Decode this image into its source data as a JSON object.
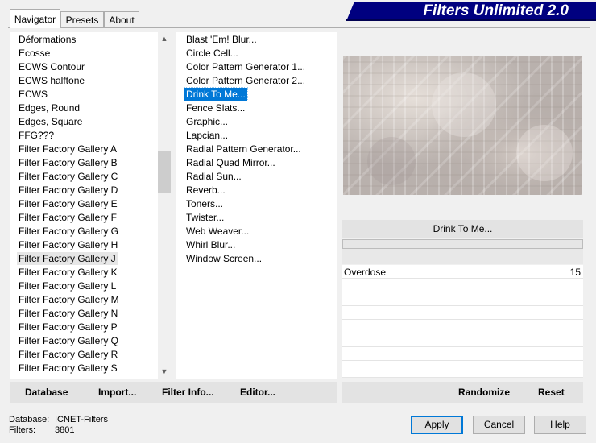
{
  "banner": {
    "title": "Filters Unlimited 2.0"
  },
  "tabs": [
    {
      "label": "Navigator",
      "active": true
    },
    {
      "label": "Presets",
      "active": false
    },
    {
      "label": "About",
      "active": false
    }
  ],
  "categories": [
    "Déformations",
    "Ecosse",
    "ECWS Contour",
    "ECWS halftone",
    "ECWS",
    "Edges, Round",
    "Edges, Square",
    "FFG???",
    "Filter Factory Gallery A",
    "Filter Factory Gallery B",
    "Filter Factory Gallery C",
    "Filter Factory Gallery D",
    "Filter Factory Gallery E",
    "Filter Factory Gallery F",
    "Filter Factory Gallery G",
    "Filter Factory Gallery H",
    "Filter Factory Gallery J",
    "Filter Factory Gallery K",
    "Filter Factory Gallery L",
    "Filter Factory Gallery M",
    "Filter Factory Gallery N",
    "Filter Factory Gallery P",
    "Filter Factory Gallery Q",
    "Filter Factory Gallery R",
    "Filter Factory Gallery S"
  ],
  "selected_category": "Filter Factory Gallery J",
  "filters": [
    "Blast 'Em! Blur...",
    "Circle Cell...",
    "Color Pattern Generator 1...",
    "Color Pattern Generator 2...",
    "Drink To Me...",
    "Fence Slats...",
    "Graphic...",
    "Lapcian...",
    "Radial Pattern Generator...",
    "Radial Quad Mirror...",
    "Radial Sun...",
    "Reverb...",
    "Toners...",
    "Twister...",
    "Web Weaver...",
    "Whirl Blur...",
    "Window Screen..."
  ],
  "selected_filter": "Drink To Me...",
  "preview": {
    "filter_name": "Drink To Me..."
  },
  "params": [
    {
      "name": "Overdose",
      "value": "15"
    }
  ],
  "left_buttons": {
    "database": "Database",
    "import": "Import...",
    "filter_info": "Filter Info...",
    "editor": "Editor..."
  },
  "right_buttons": {
    "randomize": "Randomize",
    "reset": "Reset"
  },
  "status": {
    "database_label": "Database:",
    "database_value": "ICNET-Filters",
    "filters_label": "Filters:",
    "filters_value": "3801"
  },
  "dialog_buttons": {
    "apply": "Apply",
    "cancel": "Cancel",
    "help": "Help"
  },
  "colors": {
    "banner": "#000080",
    "selection": "#0078d7"
  }
}
